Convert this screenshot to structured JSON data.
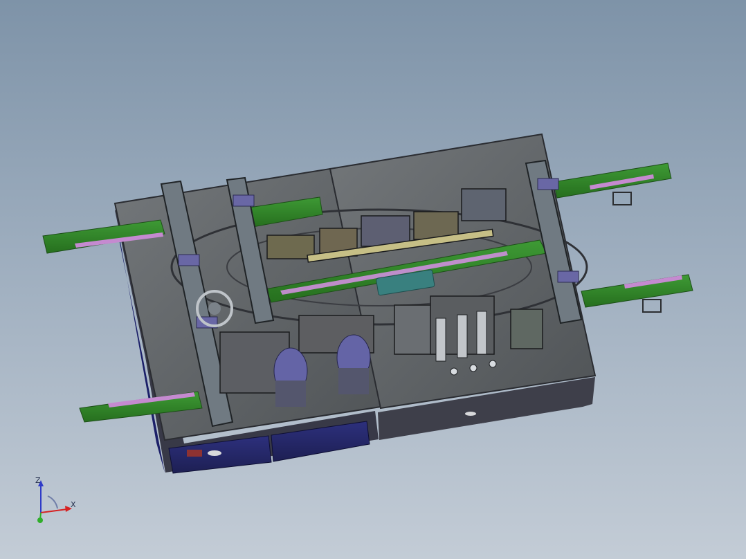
{
  "viewport": {
    "background_top": "#7e93a8",
    "background_bottom": "#c3ccd6"
  },
  "model": {
    "name_icon": "assembly-machine-model",
    "colors": {
      "plate": "#666a6d",
      "frame": "#2b2d74",
      "conveyor": "#2e7d25",
      "gantry": "#7b858d",
      "accent": "#8f4b9d",
      "motor": "#6566a8"
    }
  },
  "triad": {
    "z_label": "Z",
    "x_label": "X",
    "x_color": "#d62323",
    "z_color": "#2f3bc8",
    "y_color": "#2fae2a",
    "icon": "coordinate-axis-icon"
  }
}
